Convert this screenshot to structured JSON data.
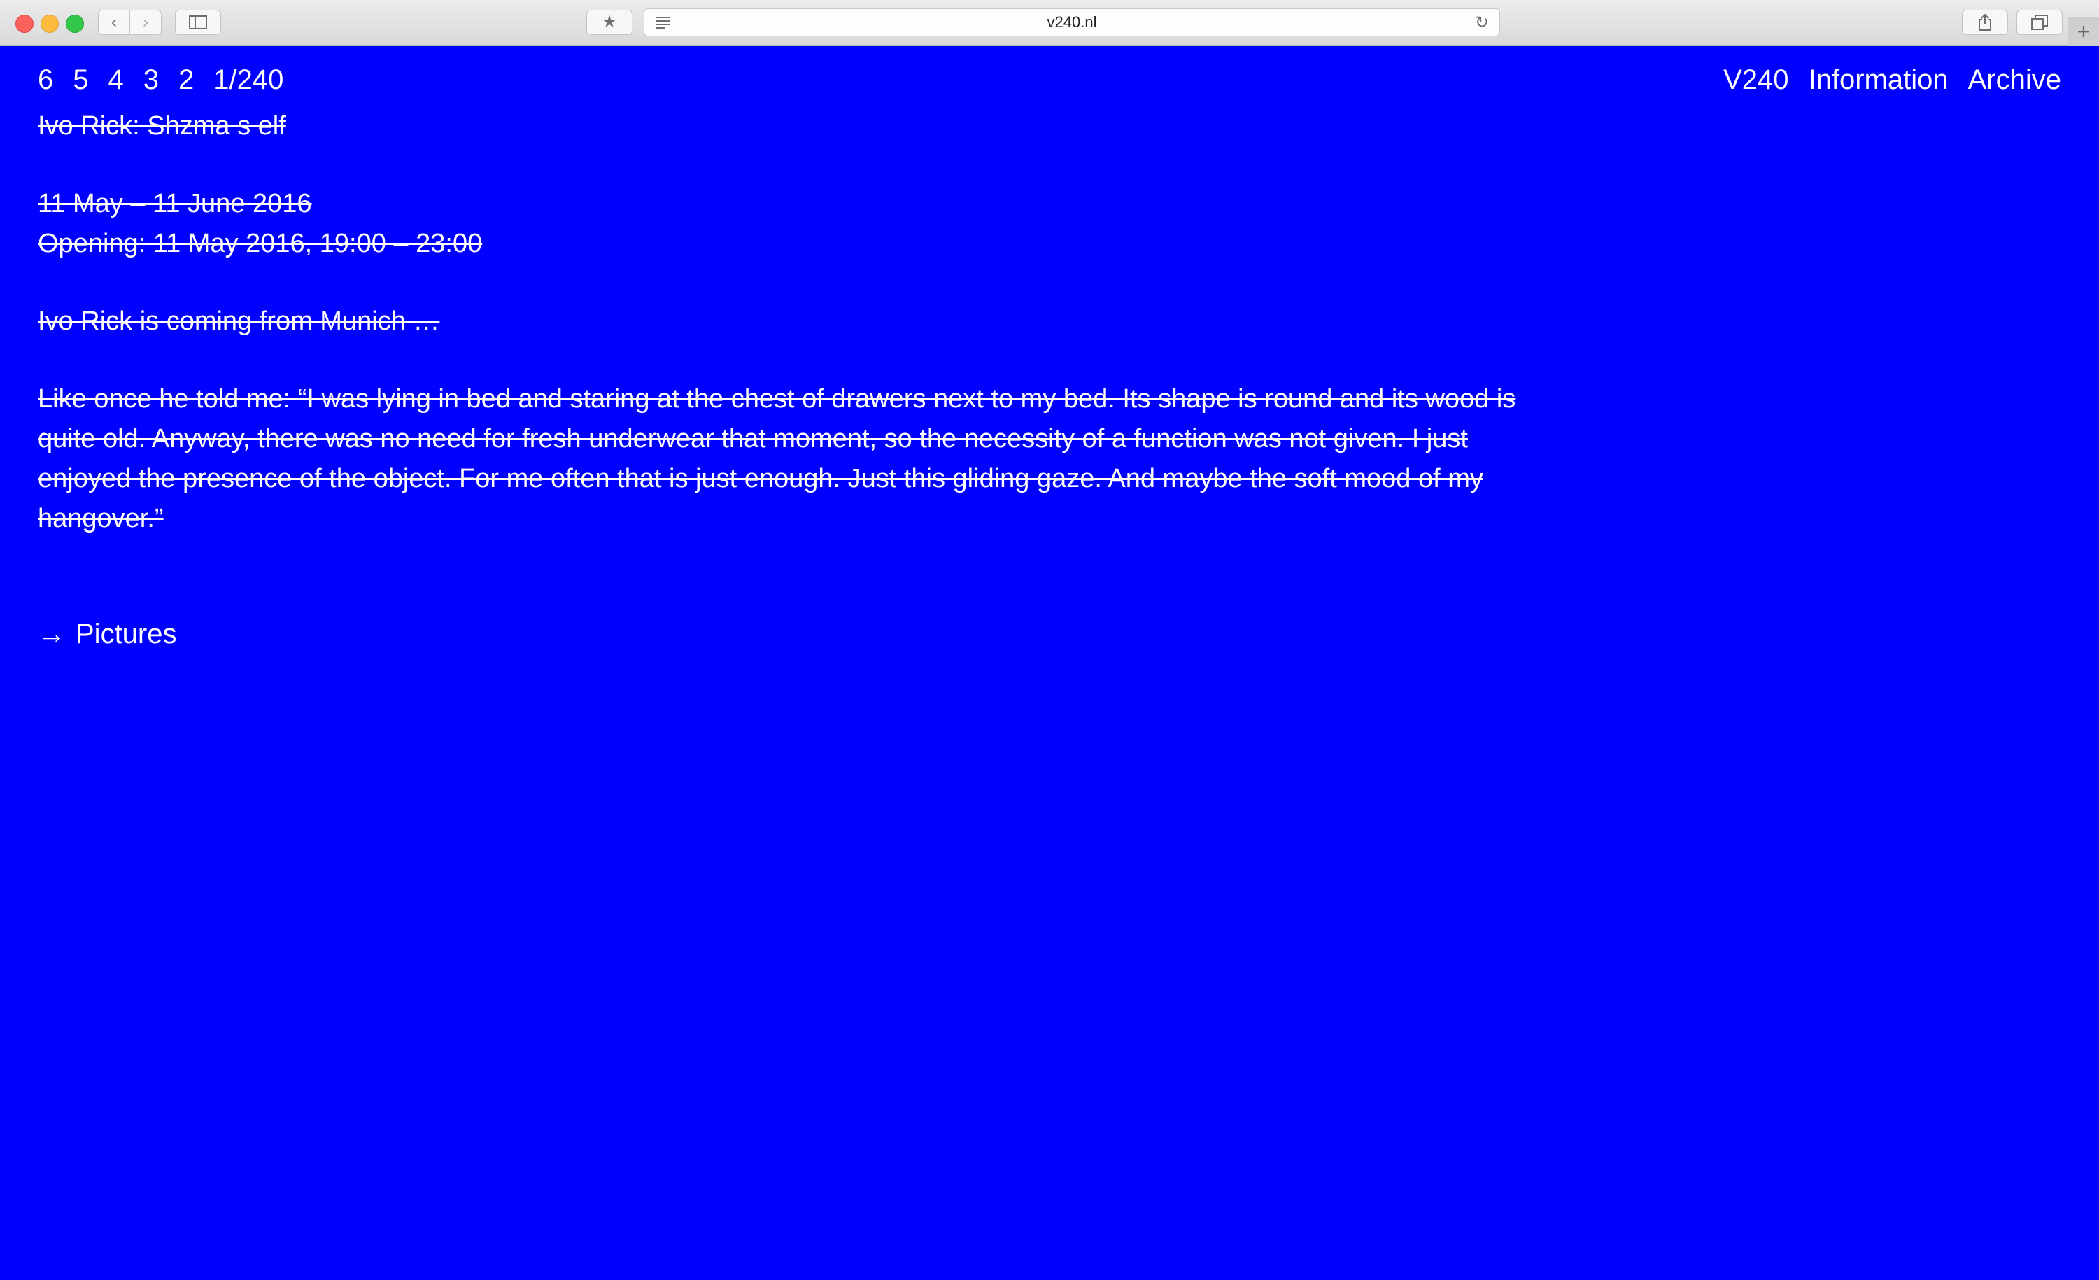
{
  "browser": {
    "url": "v240.nl",
    "icons": {
      "back": "chevron-left-icon",
      "forward": "chevron-right-icon",
      "sidebar": "sidebar-icon",
      "favorites": "star-icon",
      "reader": "reader-icon",
      "reload": "reload-icon",
      "share": "share-icon",
      "tabs": "tabs-icon",
      "new_tab": "plus-icon"
    }
  },
  "pager": [
    "6",
    "5",
    "4",
    "3",
    "2",
    "1/240"
  ],
  "nav": {
    "home": "V240",
    "information": "Information",
    "archive": "Archive"
  },
  "exhibition": {
    "title": "Ivo Rick: Shzma s elf",
    "dates": "11 May – 11 June 2016",
    "opening": "Opening: 11 May 2016, 19:00 – 23:00",
    "intro": "Ivo Rick is coming from Munich …",
    "quote": "Like once he told me: “I was lying in bed and staring at the chest of drawers next to my bed. Its shape is round and its wood is quite old. Anyway, there was no need for fresh underwear that moment, so the necessity of a function was not given. I just enjoyed the presence of the object. For me often that is just enough. Just this gliding gaze. And maybe the soft mood of my hangover.”"
  },
  "pictures_link": {
    "arrow": "→",
    "label": "Pictures"
  },
  "colors": {
    "background": "#0000ff",
    "text": "#ffffff"
  }
}
